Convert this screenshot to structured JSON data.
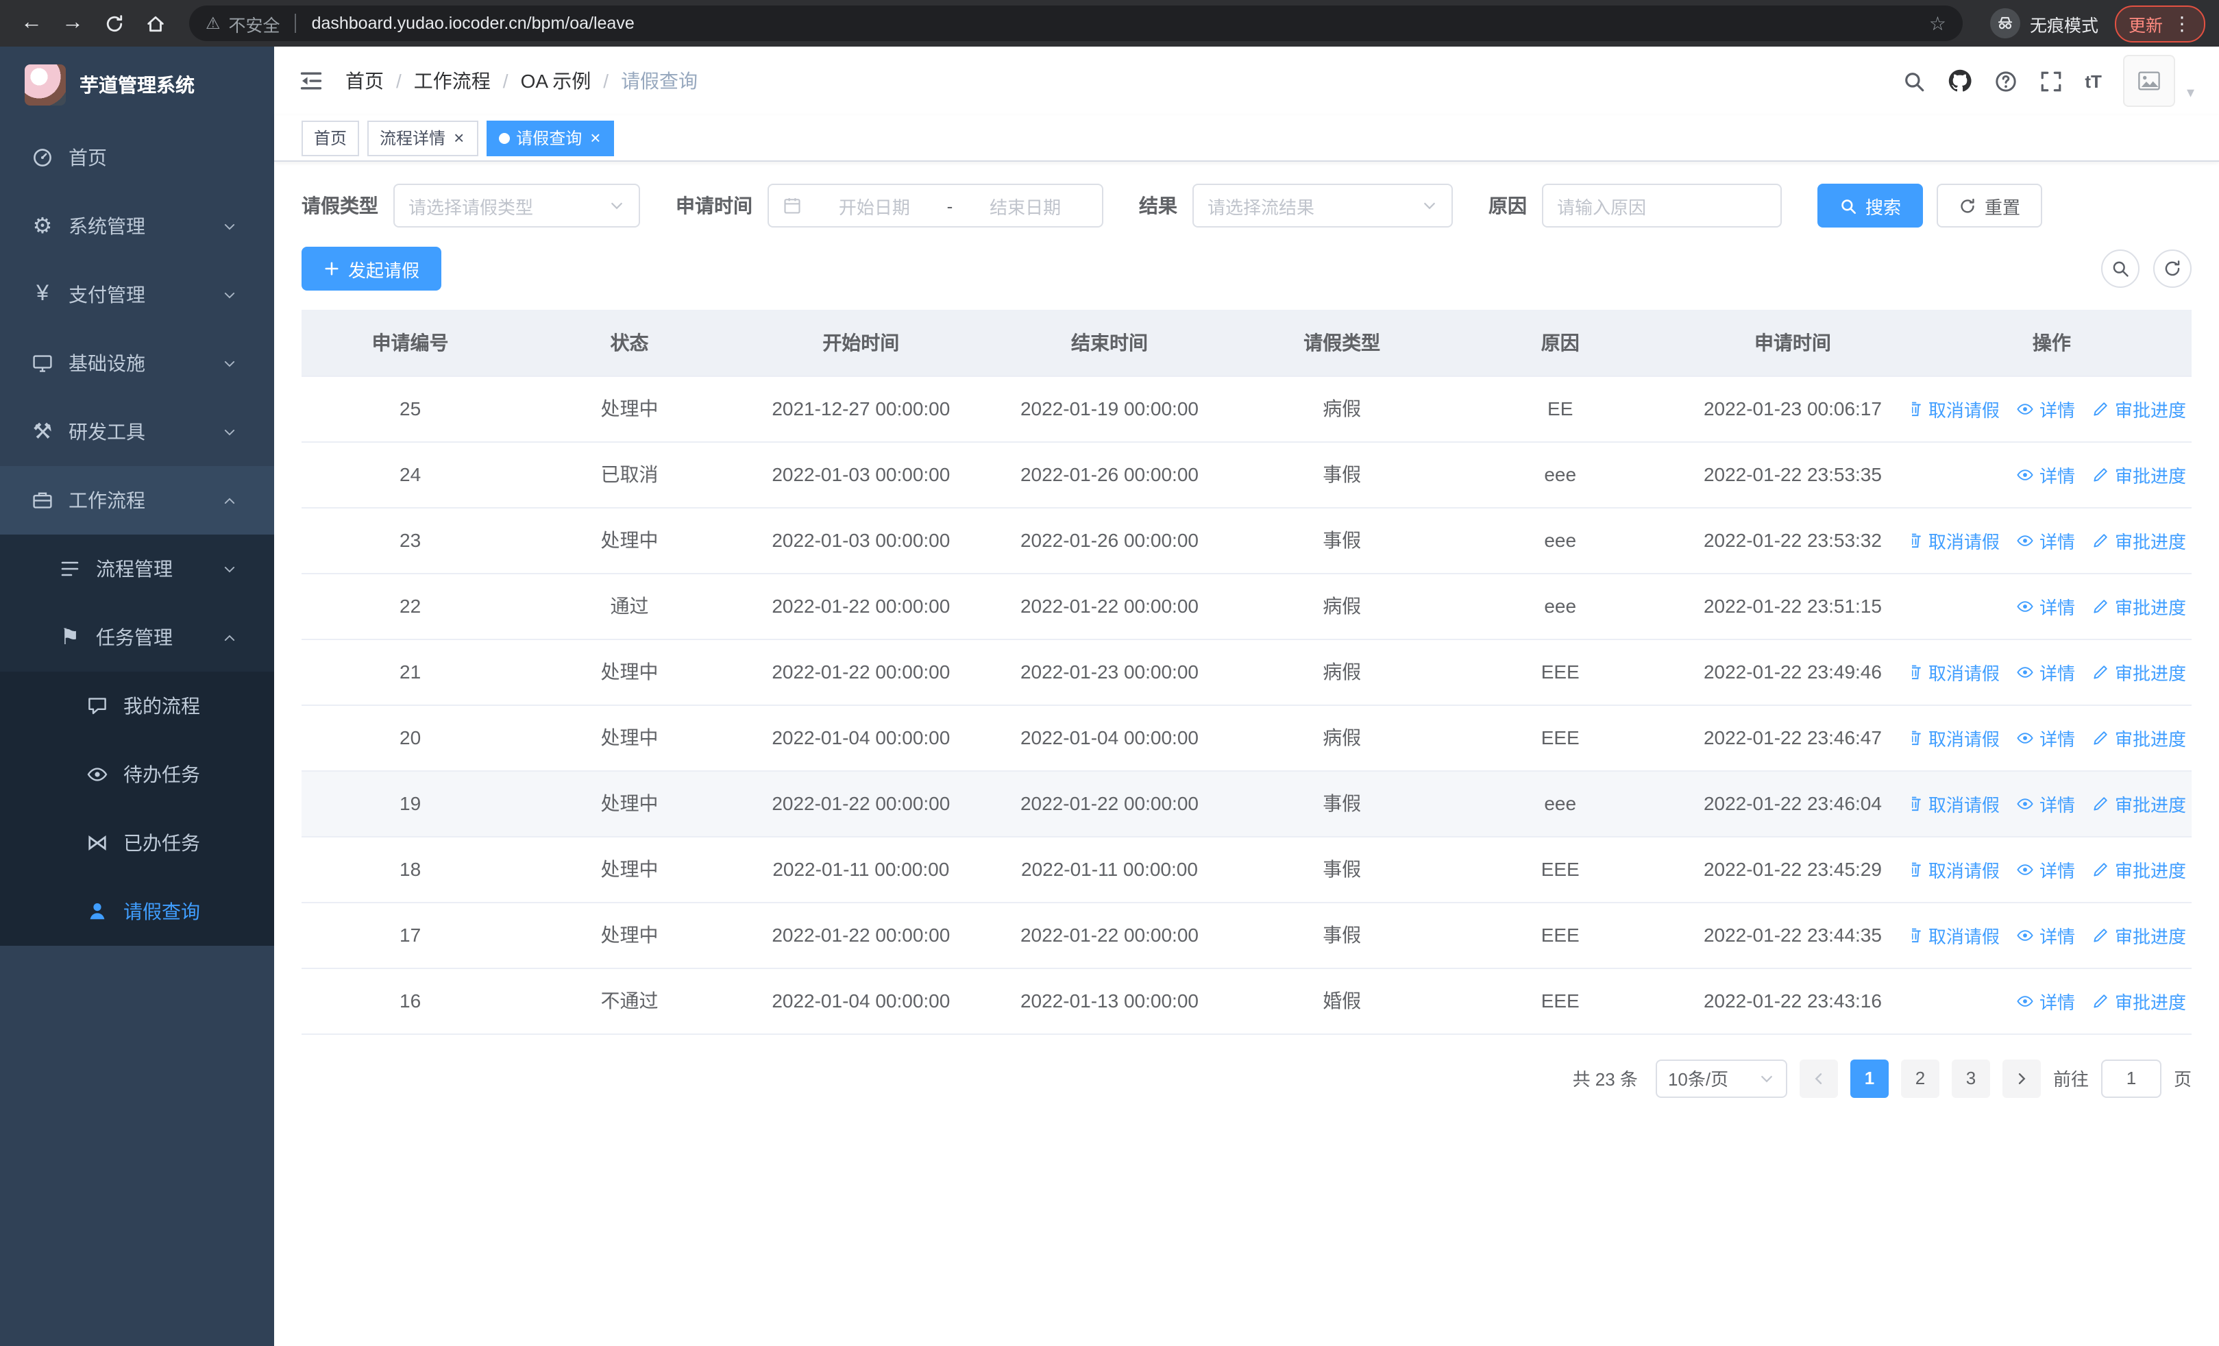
{
  "browser": {
    "security_label": "不安全",
    "url": "dashboard.yudao.iocoder.cn/bpm/oa/leave",
    "incognito_label": "无痕模式",
    "update_label": "更新"
  },
  "sidebar": {
    "logo_title": "芋道管理系统",
    "items": [
      {
        "name": "home",
        "label": "首页",
        "icon": "dashboard-icon",
        "level": 1
      },
      {
        "name": "system-management",
        "label": "系统管理",
        "icon": "gear-icon",
        "level": 1,
        "arrow": "down"
      },
      {
        "name": "payment-management",
        "label": "支付管理",
        "icon": "payment-icon",
        "level": 1,
        "arrow": "down"
      },
      {
        "name": "infrastructure",
        "label": "基础设施",
        "icon": "infrastructure-icon",
        "level": 1,
        "arrow": "down"
      },
      {
        "name": "dev-tools",
        "label": "研发工具",
        "icon": "tools-icon",
        "level": 1,
        "arrow": "down"
      },
      {
        "name": "workflow",
        "label": "工作流程",
        "icon": "workflow-icon",
        "level": 1,
        "arrow": "up",
        "highlight": true
      },
      {
        "name": "process-management",
        "label": "流程管理",
        "icon": "process-icon",
        "level": 2,
        "arrow": "down"
      },
      {
        "name": "task-management",
        "label": "任务管理",
        "icon": "task-icon",
        "level": 2,
        "arrow": "up"
      },
      {
        "name": "my-process",
        "label": "我的流程",
        "icon": "my-process-icon",
        "level": 3
      },
      {
        "name": "todo-tasks",
        "label": "待办任务",
        "icon": "todo-icon",
        "level": 3
      },
      {
        "name": "done-tasks",
        "label": "已办任务",
        "icon": "done-icon",
        "level": 3
      },
      {
        "name": "leave-query",
        "label": "请假查询",
        "icon": "leave-icon",
        "level": 3,
        "active": true
      }
    ]
  },
  "header": {
    "breadcrumb": [
      "首页",
      "工作流程",
      "OA 示例",
      "请假查询"
    ]
  },
  "tabs": [
    {
      "label": "首页",
      "closable": false,
      "active": false
    },
    {
      "label": "流程详情",
      "closable": true,
      "active": false
    },
    {
      "label": "请假查询",
      "closable": true,
      "active": true
    }
  ],
  "filters": {
    "leave_type_label": "请假类型",
    "leave_type_placeholder": "请选择请假类型",
    "apply_time_label": "申请时间",
    "start_placeholder": "开始日期",
    "range_separator": "-",
    "end_placeholder": "结束日期",
    "result_label": "结果",
    "result_placeholder": "请选择流结果",
    "reason_label": "原因",
    "reason_placeholder": "请输入原因",
    "search_label": "搜索",
    "reset_label": "重置"
  },
  "toolbar": {
    "create_label": "发起请假"
  },
  "table": {
    "columns": [
      "申请编号",
      "状态",
      "开始时间",
      "结束时间",
      "请假类型",
      "原因",
      "申请时间",
      "操作"
    ],
    "action_labels": {
      "cancel": "取消请假",
      "detail": "详情",
      "progress": "审批进度"
    },
    "rows": [
      {
        "id": "25",
        "status": "处理中",
        "start": "2021-12-27 00:00:00",
        "end": "2022-01-19 00:00:00",
        "type": "病假",
        "reason": "EE",
        "apply_time": "2022-01-23 00:06:17",
        "actions": [
          "cancel",
          "detail",
          "progress"
        ],
        "hover": false
      },
      {
        "id": "24",
        "status": "已取消",
        "start": "2022-01-03 00:00:00",
        "end": "2022-01-26 00:00:00",
        "type": "事假",
        "reason": "eee",
        "apply_time": "2022-01-22 23:53:35",
        "actions": [
          "detail",
          "progress"
        ],
        "hover": false
      },
      {
        "id": "23",
        "status": "处理中",
        "start": "2022-01-03 00:00:00",
        "end": "2022-01-26 00:00:00",
        "type": "事假",
        "reason": "eee",
        "apply_time": "2022-01-22 23:53:32",
        "actions": [
          "cancel",
          "detail",
          "progress"
        ],
        "hover": false
      },
      {
        "id": "22",
        "status": "通过",
        "start": "2022-01-22 00:00:00",
        "end": "2022-01-22 00:00:00",
        "type": "病假",
        "reason": "eee",
        "apply_time": "2022-01-22 23:51:15",
        "actions": [
          "detail",
          "progress"
        ],
        "hover": false
      },
      {
        "id": "21",
        "status": "处理中",
        "start": "2022-01-22 00:00:00",
        "end": "2022-01-23 00:00:00",
        "type": "病假",
        "reason": "EEE",
        "apply_time": "2022-01-22 23:49:46",
        "actions": [
          "cancel",
          "detail",
          "progress"
        ],
        "hover": false
      },
      {
        "id": "20",
        "status": "处理中",
        "start": "2022-01-04 00:00:00",
        "end": "2022-01-04 00:00:00",
        "type": "病假",
        "reason": "EEE",
        "apply_time": "2022-01-22 23:46:47",
        "actions": [
          "cancel",
          "detail",
          "progress"
        ],
        "hover": false
      },
      {
        "id": "19",
        "status": "处理中",
        "start": "2022-01-22 00:00:00",
        "end": "2022-01-22 00:00:00",
        "type": "事假",
        "reason": "eee",
        "apply_time": "2022-01-22 23:46:04",
        "actions": [
          "cancel",
          "detail",
          "progress"
        ],
        "hover": true
      },
      {
        "id": "18",
        "status": "处理中",
        "start": "2022-01-11 00:00:00",
        "end": "2022-01-11 00:00:00",
        "type": "事假",
        "reason": "EEE",
        "apply_time": "2022-01-22 23:45:29",
        "actions": [
          "cancel",
          "detail",
          "progress"
        ],
        "hover": false
      },
      {
        "id": "17",
        "status": "处理中",
        "start": "2022-01-22 00:00:00",
        "end": "2022-01-22 00:00:00",
        "type": "事假",
        "reason": "EEE",
        "apply_time": "2022-01-22 23:44:35",
        "actions": [
          "cancel",
          "detail",
          "progress"
        ],
        "hover": false
      },
      {
        "id": "16",
        "status": "不通过",
        "start": "2022-01-04 00:00:00",
        "end": "2022-01-13 00:00:00",
        "type": "婚假",
        "reason": "EEE",
        "apply_time": "2022-01-22 23:43:16",
        "actions": [
          "detail",
          "progress"
        ],
        "hover": false
      }
    ]
  },
  "pagination": {
    "total_label": "共 23 条",
    "page_size_label": "10条/页",
    "pages": [
      "1",
      "2",
      "3"
    ],
    "active_page": "1",
    "goto_label": "前往",
    "goto_value": "1",
    "goto_suffix": "页"
  },
  "colors": {
    "primary": "#409EFF",
    "sidebar_bg": "#304156",
    "submenu_bg": "#1f2d3d",
    "table_header_bg": "#eef1f6",
    "update_chip": "#e25142"
  }
}
